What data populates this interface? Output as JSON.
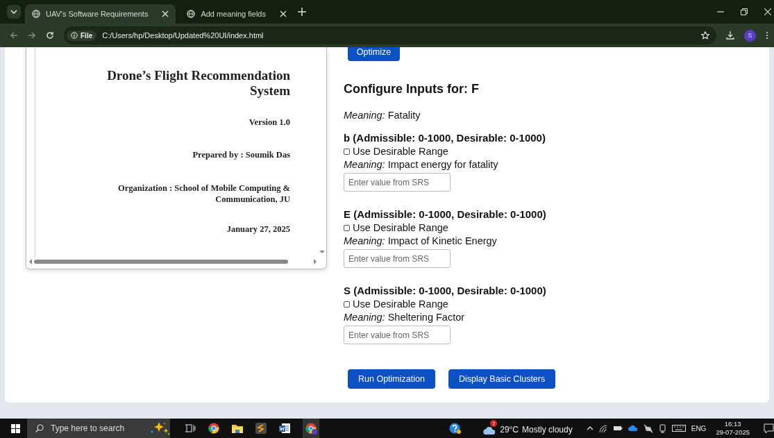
{
  "browser": {
    "tabs": [
      {
        "title": "UAV's Software Requirements",
        "selected": true
      },
      {
        "title": "Add meaning fields",
        "selected": false
      }
    ],
    "address": {
      "badge": "File",
      "url": "C:/Users/hp/Desktop/Updated%20UI/index.html"
    },
    "profile": "S"
  },
  "document_preview": {
    "title": "Drone’s Flight Recommendation System",
    "version": "Version 1.0",
    "prepared_by": "Prepared by : Soumik Das",
    "organization": "Organization : School of Mobile Computing & Communication, JU",
    "date": "January 27, 2025"
  },
  "form": {
    "optimize_button": "Optimize",
    "heading": "Configure Inputs for: F",
    "meaning": "*Meaning:* Fatality",
    "params": [
      {
        "title": "b (Admissible: 0-1000, Desirable: 0-1000)",
        "checkbox_label": "Use Desirable Range",
        "checked": false,
        "meaning": "*Meaning:* Impact energy for fatality",
        "placeholder": "Enter value from SRS"
      },
      {
        "title": "E (Admissible: 0-1000, Desirable: 0-1000)",
        "checkbox_label": "Use Desirable Range",
        "checked": false,
        "meaning": "*Meaning:* Impact of Kinetic Energy",
        "placeholder": "Enter value from SRS"
      },
      {
        "title": "S (Admissible: 0-1000, Desirable: 0-1000)",
        "checkbox_label": "Use Desirable Range",
        "checked": false,
        "meaning": "*Meaning:* Sheltering Factor",
        "placeholder": "Enter value from SRS"
      }
    ],
    "buttons": [
      "Run Optimization",
      "Display Basic Clusters"
    ]
  },
  "taskbar": {
    "search_placeholder": "Type here to search",
    "weather": {
      "badge": "7",
      "temperature": "29°C",
      "condition": "Mostly cloudy"
    },
    "language": "ENG",
    "time": "16:13",
    "date": "29-07-2025"
  }
}
